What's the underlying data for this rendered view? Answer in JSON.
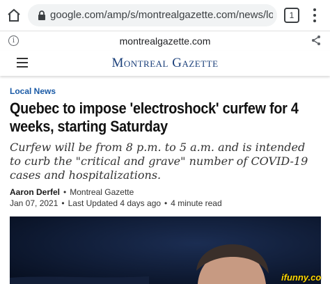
{
  "browser": {
    "url": "google.com/amp/s/montrealgazette.com/news/local-news/c",
    "tab_count": "1",
    "site_domain": "montrealgazette.com"
  },
  "site": {
    "logo_text": "Montreal Gazette"
  },
  "article": {
    "section": "Local News",
    "headline": "Quebec to impose 'electroshock' curfew for 4 weeks, starting Saturday",
    "dek": "Curfew will be from 8 p.m. to 5 a.m. and is intended to curb the \"critical and grave\" number of COVID-19 cases and hospitalizations.",
    "author": "Aaron Derfel",
    "publication": "Montreal Gazette",
    "published": "Jan 07, 2021",
    "updated": "Last Updated 4 days ago",
    "read_time": "4 minute read"
  },
  "watermark": "ifunny.co",
  "colors": {
    "logo": "#1a3f7a",
    "section_label": "#1a5aa6",
    "hero_bg": "#0c1a33"
  }
}
